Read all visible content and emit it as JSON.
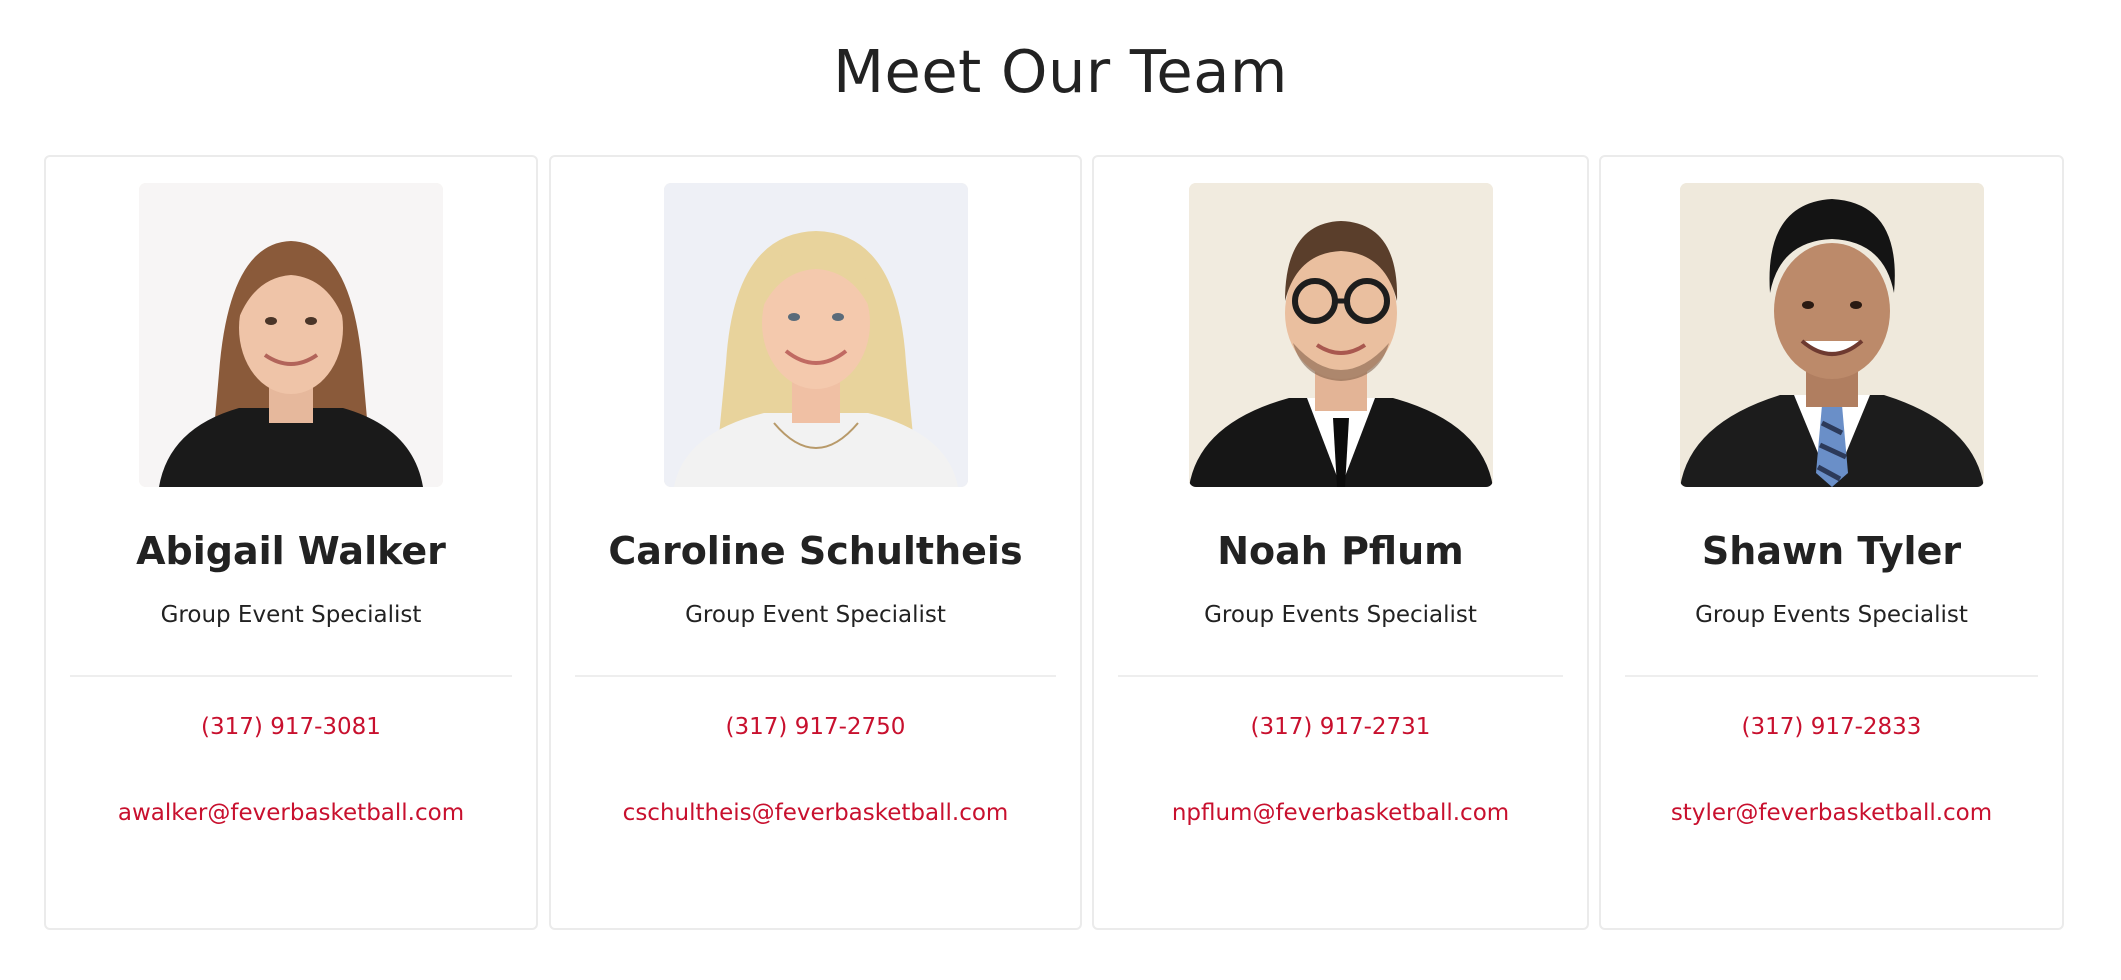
{
  "section": {
    "title": "Meet Our Team"
  },
  "colors": {
    "accent": "#c8102e",
    "text": "#222222",
    "border": "#ebebeb"
  },
  "team": [
    {
      "name": "Abigail Walker",
      "role": "Group Event Specialist",
      "phone": "(317) 917-3081",
      "email": "awalker@feverbasketball.com",
      "photo_icon": "person-portrait"
    },
    {
      "name": "Caroline Schultheis",
      "role": "Group Event Specialist",
      "phone": "(317) 917-2750",
      "email": "cschultheis@feverbasketball.com",
      "photo_icon": "person-portrait"
    },
    {
      "name": "Noah Pflum",
      "role": "Group Events Specialist",
      "phone": "(317) 917-2731",
      "email": "npflum@feverbasketball.com",
      "photo_icon": "person-portrait"
    },
    {
      "name": "Shawn Tyler",
      "role": "Group Events Specialist",
      "phone": "(317) 917-2833",
      "email": "styler@feverbasketball.com",
      "photo_icon": "person-portrait"
    }
  ]
}
